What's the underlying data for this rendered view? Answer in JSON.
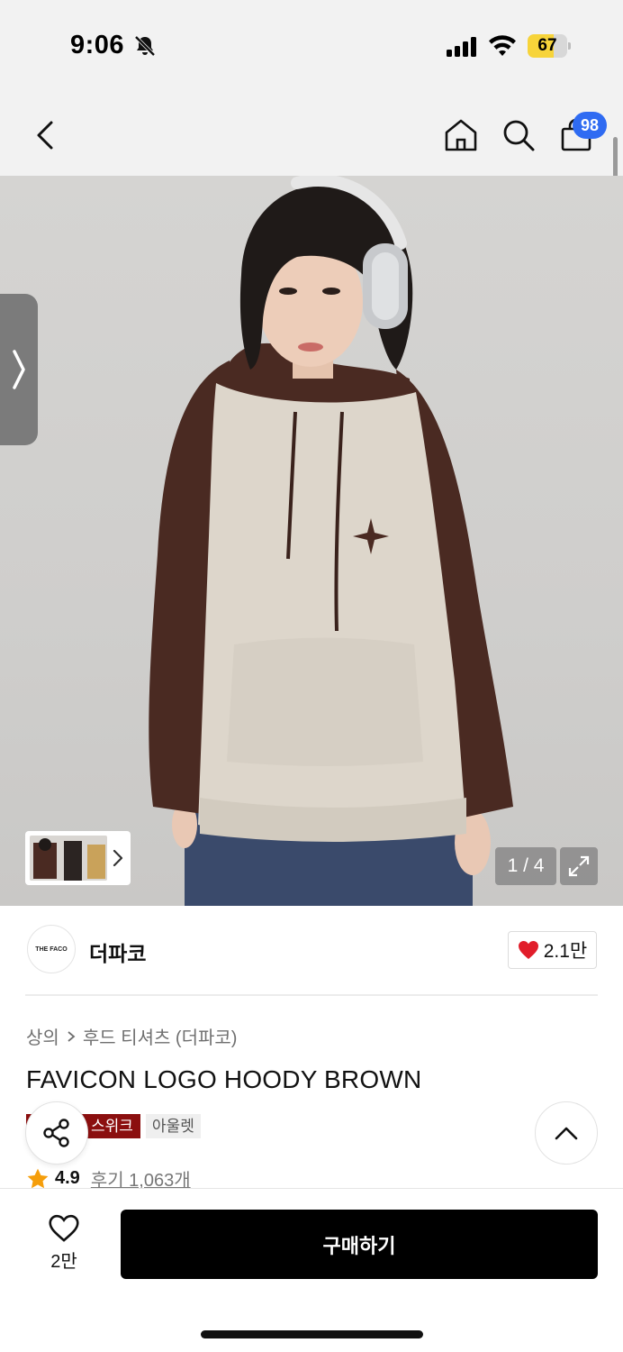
{
  "status": {
    "time": "9:06",
    "battery": "67",
    "battery_level": 0.67,
    "icons": [
      "bell-slash-icon",
      "cellular-signal-icon",
      "wifi-icon",
      "battery-icon"
    ]
  },
  "nav": {
    "cart_count": "98",
    "icons": [
      "chevron-left-icon",
      "home-icon",
      "search-icon",
      "shopping-bag-icon"
    ]
  },
  "gallery": {
    "counter": "1 / 4",
    "current_page": 1,
    "total_pages": 4
  },
  "brand": {
    "logo_text": "THE FACO",
    "name": "더파코",
    "likes": "2.1만"
  },
  "breadcrumb": {
    "category": "상의",
    "subcategory": "후드 티셔츠 (더파코)"
  },
  "product": {
    "title": "FAVICON LOGO HOODY BROWN",
    "badge_event_visible": "스위크",
    "badge_outlet": "아울렛",
    "rating": "4.9",
    "reviews": "후기 1,063개"
  },
  "bottom": {
    "wish_count": "2만",
    "buy_label": "구매하기"
  },
  "colors": {
    "accent_blue": "#2f6bf2",
    "heart_red": "#e11d2a",
    "badge_red": "#8b0f0f",
    "star_orange": "#f59e0b"
  }
}
